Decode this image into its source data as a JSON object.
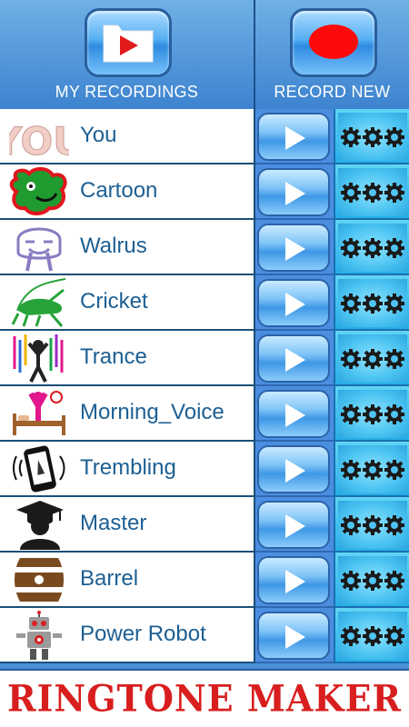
{
  "header": {
    "recordings_label": "MY RECORDINGS",
    "record_new_label": "RECORD NEW"
  },
  "effects": [
    {
      "label": "You",
      "icon": "you-text-icon"
    },
    {
      "label": "Cartoon",
      "icon": "cartoon-face-icon"
    },
    {
      "label": "Walrus",
      "icon": "walrus-icon"
    },
    {
      "label": "Cricket",
      "icon": "cricket-icon"
    },
    {
      "label": "Trance",
      "icon": "trance-icon"
    },
    {
      "label": "Morning_Voice",
      "icon": "morning-voice-icon"
    },
    {
      "label": "Trembling",
      "icon": "trembling-phone-icon"
    },
    {
      "label": "Master",
      "icon": "master-graduate-icon"
    },
    {
      "label": "Barrel",
      "icon": "barrel-icon"
    },
    {
      "label": "Power Robot",
      "icon": "robot-icon"
    }
  ],
  "footer": {
    "title": "RINGTONE MAKER"
  },
  "colors": {
    "header_blue": "#4a90d9",
    "label_blue": "#1c5f93",
    "footer_red": "#d81e1e",
    "record_red": "#ff0000"
  }
}
